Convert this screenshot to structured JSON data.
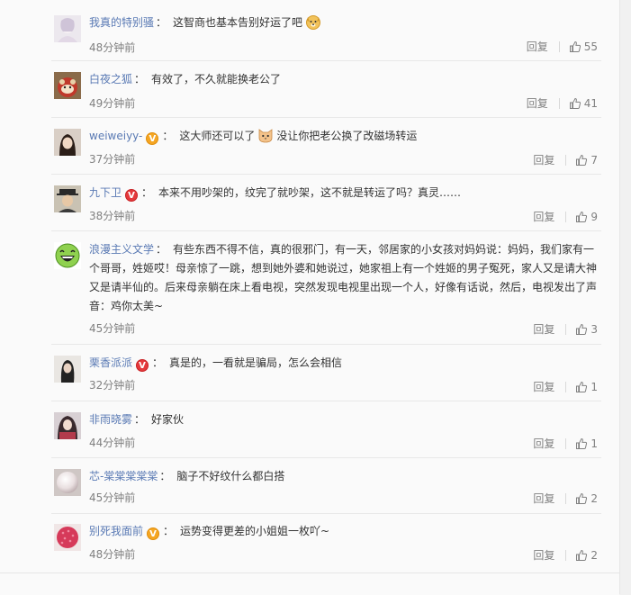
{
  "comments": [
    {
      "username": "我真的特别骚",
      "text": "这智商也基本告别好运了吧",
      "time": "48分钟前",
      "reply_label": "回复",
      "likes": "55"
    },
    {
      "username": "白夜之狐",
      "text": "有效了，不久就能换老公了",
      "time": "49分钟前",
      "reply_label": "回复",
      "likes": "41"
    },
    {
      "username": "weiweiyy-",
      "text_before": "这大师还可以了",
      "text_after": "没让你把老公换了改磁场转运",
      "time": "37分钟前",
      "reply_label": "回复",
      "likes": "7"
    },
    {
      "username": "九下卫",
      "text": "本来不用吵架的，纹完了就吵架，这不就是转运了吗？真灵……",
      "time": "38分钟前",
      "reply_label": "回复",
      "likes": "9"
    },
    {
      "username": "浪漫主义文学",
      "text": "有些东西不得不信，真的很邪门，有一天，邻居家的小女孩对妈妈说：妈妈，我们家有一个哥哥，姓姬哎！母亲惊了一跳，想到她外婆和她说过，她家祖上有一个姓姬的男子冤死，家人又是请大神又是请半仙的。后来母亲躺在床上看电视，突然发现电视里出现一个人，好像有话说，然后，电视发出了声音：鸡你太美~",
      "time": "45分钟前",
      "reply_label": "回复",
      "likes": "3"
    },
    {
      "username": "栗香派派",
      "text": "真是的，一看就是骗局，怎么会相信",
      "time": "32分钟前",
      "reply_label": "回复",
      "likes": "1"
    },
    {
      "username": "非雨晓雾",
      "text": "好家伙",
      "time": "44分钟前",
      "reply_label": "回复",
      "likes": "1"
    },
    {
      "username": "芯-棠棠棠棠棠",
      "text": "脑子不好纹什么都白搭",
      "time": "45分钟前",
      "reply_label": "回复",
      "likes": "2"
    },
    {
      "username": "别死我面前",
      "text": "运势变得更差的小姐姐一枚吖~",
      "time": "48分钟前",
      "reply_label": "回复",
      "likes": "2"
    }
  ],
  "colon": "：",
  "badges": {
    "v_orange": "V",
    "v_red": "V"
  },
  "colors": {
    "username": "#5a7ab4",
    "text": "#333333",
    "meta": "#808080",
    "badge_orange": "#f5a623",
    "badge_red": "#e4393c"
  },
  "icons": {
    "like": "thumbs-up-icon",
    "badge": "verified-v-badge"
  }
}
